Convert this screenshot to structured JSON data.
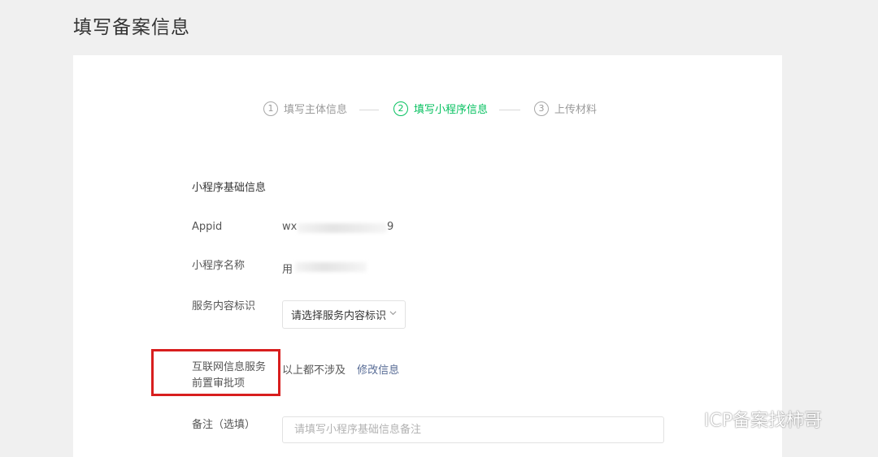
{
  "page": {
    "title": "填写备案信息"
  },
  "steps": [
    {
      "num": "1",
      "label": "填写主体信息",
      "state": "done"
    },
    {
      "num": "2",
      "label": "填写小程序信息",
      "state": "active"
    },
    {
      "num": "3",
      "label": "上传材料",
      "state": "pending"
    }
  ],
  "form": {
    "section_title": "小程序基础信息",
    "appid": {
      "label": "Appid",
      "value_prefix": "wx",
      "value_suffix": "9"
    },
    "name": {
      "label": "小程序名称",
      "value_prefix": "用"
    },
    "service_tag": {
      "label": "服务内容标识",
      "selected": "请选择服务内容标识"
    },
    "pre_approval": {
      "label_line1": "互联网信息服务",
      "label_line2": "前置审批项",
      "value": "以上都不涉及",
      "edit_link": "修改信息"
    },
    "remark": {
      "label": "备注（选填）",
      "placeholder": "请填写小程序基础信息备注"
    }
  },
  "watermark": {
    "text": "ICP备案找柿哥",
    "icon": "wechat-icon"
  },
  "colors": {
    "accent": "#07c160",
    "link": "#576b95",
    "highlight": "#d81e1e"
  }
}
